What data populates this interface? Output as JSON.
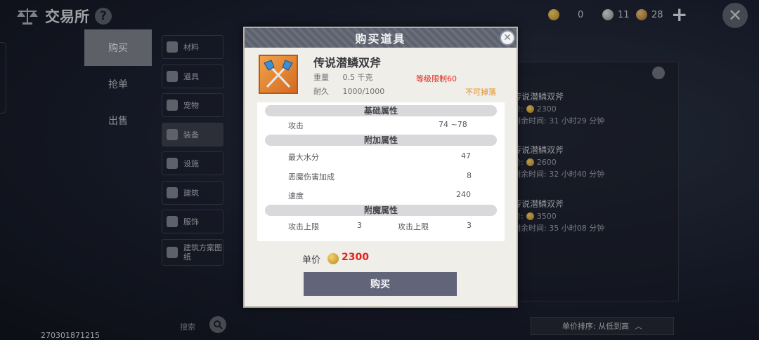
{
  "header": {
    "title": "交易所",
    "help_icon": "?",
    "currencies": [
      {
        "icon": "gold-coin-icon",
        "value": "0"
      },
      {
        "icon": "silver-coin-icon",
        "value": "11"
      },
      {
        "icon": "bronze-coin-icon",
        "value": "28"
      }
    ],
    "add_icon": "+"
  },
  "left_tabs": [
    "购买",
    "抢单",
    "出售"
  ],
  "categories": [
    "材料",
    "道具",
    "宠物",
    "装备",
    "设施",
    "建筑",
    "服饰",
    "建筑方案图纸"
  ],
  "search_label": "搜索",
  "uid": "270301871215",
  "listings": [
    {
      "name": "传说潜鳞双斧",
      "price_prefix": "价:",
      "price": "2300",
      "time": "剩余时间: 31 小时29 分钟"
    },
    {
      "name": "传说潜鳞双斧",
      "price_prefix": "价:",
      "price": "2600",
      "time": "剩余时间: 32 小时40 分钟"
    },
    {
      "name": "传说潜鳞双斧",
      "price_prefix": "价:",
      "price": "3500",
      "time": "剩余时间: 35 小时08 分钟"
    }
  ],
  "sort_label": "单价排序: 从低到高",
  "modal": {
    "title": "购买道具",
    "item_name": "传说潜鳞双斧",
    "item_icon": "twin-axes-icon",
    "weight_label": "重量",
    "weight_value": "0.5 千克",
    "durability_label": "耐久",
    "durability_value": "1000/1000",
    "level_req": "等级限制60",
    "no_drop": "不可掉落",
    "sections": {
      "basic": "基础属性",
      "extra": "附加属性",
      "enchant": "附魔属性"
    },
    "basic_attrs": [
      {
        "label": "攻击",
        "value": "74 ~78"
      }
    ],
    "extra_attrs": [
      {
        "label": "最大水分",
        "value": "47"
      },
      {
        "label": "恶魔伤害加成",
        "value": "8"
      },
      {
        "label": "速度",
        "value": "240"
      }
    ],
    "enchant_attrs": [
      {
        "label": "攻击上限",
        "value": "3"
      },
      {
        "label": "攻击上限",
        "value": "3"
      }
    ],
    "price_label": "单价",
    "price_value": "2300",
    "buy_label": "购买"
  },
  "colors": {
    "modal_bg": "#efeee8",
    "price_red": "#e2231b",
    "level_red": "#e0261e",
    "no_drop_orange": "#e98a17",
    "buy_button": "#62657a"
  }
}
